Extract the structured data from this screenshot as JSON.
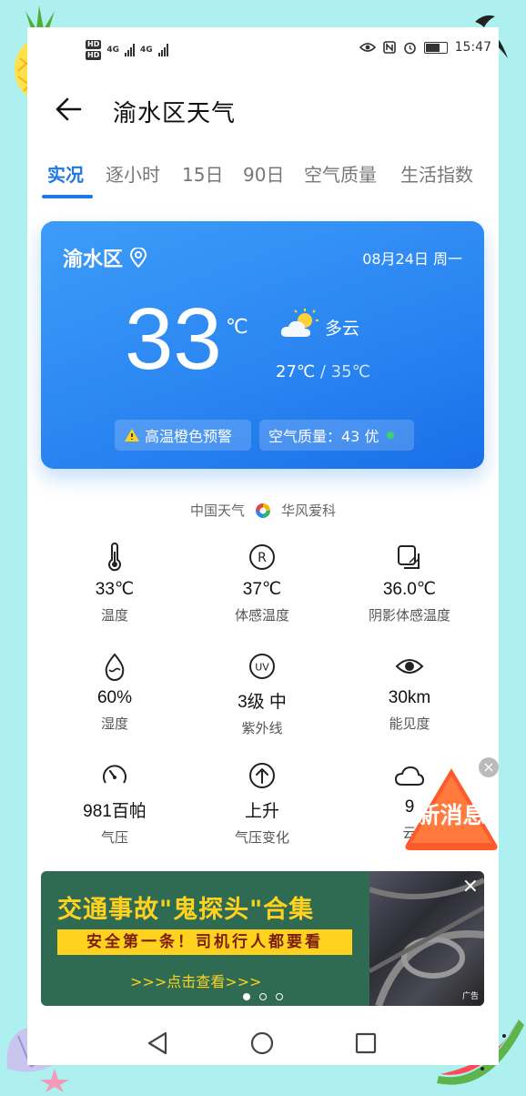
{
  "status_bar": {
    "network_badges": [
      "HD",
      "4G",
      "HD",
      "4G"
    ],
    "time": "15:47"
  },
  "header": {
    "title": "渝水区天气",
    "back_icon": "arrow-left-icon"
  },
  "tabs": [
    "实况",
    "逐小时",
    "15日",
    "90日",
    "空气质量",
    "生活指数"
  ],
  "active_tab": 0,
  "card": {
    "location": "渝水区",
    "date": "08月24日 周一",
    "temperature": "33",
    "unit": "℃",
    "condition": "多云",
    "low": "27℃",
    "separator": "/",
    "high": "35℃",
    "warning": "高温橙色预警",
    "air_quality": "空气质量：43 优",
    "colors": {
      "card": "#2b86f2",
      "aq_good": "#39d56a",
      "warning_icon": "#ffd21f"
    }
  },
  "source": {
    "left": "中国天气",
    "right": "华风爱科"
  },
  "metrics": [
    {
      "icon": "thermometer-icon",
      "value": "33℃",
      "label": "温度"
    },
    {
      "icon": "realfeel-icon",
      "value": "37℃",
      "label": "体感温度"
    },
    {
      "icon": "shade-icon",
      "value": "36.0℃",
      "label": "阴影体感温度"
    },
    {
      "icon": "humidity-icon",
      "value": "60%",
      "label": "湿度"
    },
    {
      "icon": "uv-icon",
      "value": "3级 中",
      "label": "紫外线"
    },
    {
      "icon": "eye-icon",
      "value": "30km",
      "label": "能见度"
    },
    {
      "icon": "gauge-icon",
      "value": "981百帕",
      "label": "气压"
    },
    {
      "icon": "pressure-up-icon",
      "value": "上升",
      "label": "气压变化"
    },
    {
      "icon": "cloud-icon",
      "value": "9",
      "label": "云"
    }
  ],
  "news_badge": {
    "text": "新消息"
  },
  "ad": {
    "title": "交通事故\"鬼探头\"合集",
    "subtitle": "安全第一条！司机行人都要看",
    "cta": ">>>点击查看>>>",
    "tag": "广告",
    "slides": 3,
    "active_slide": 0
  }
}
